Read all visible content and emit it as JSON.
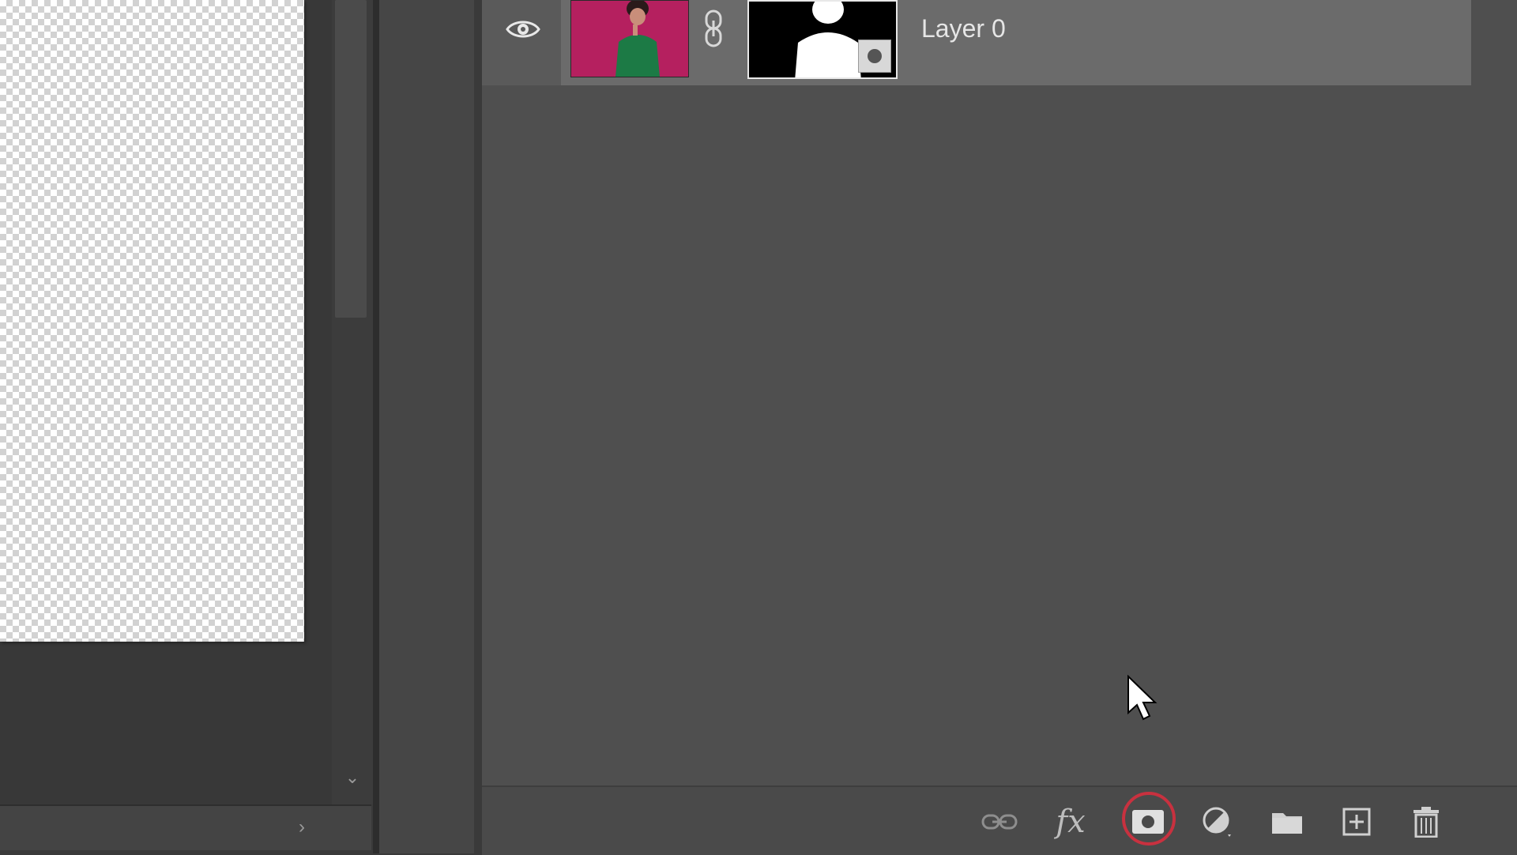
{
  "layers": [
    {
      "name": "Layer 0",
      "visible": true,
      "has_mask": true,
      "thumbnail_bg_color": "#b5205f"
    }
  ],
  "bottom_toolbar": {
    "link_icon": "link-layers-icon",
    "fx_label": "fx",
    "add_mask_icon": "add-layer-mask-icon",
    "adjustment_icon": "adjustment-layer-icon",
    "group_icon": "folder-icon",
    "new_layer_icon": "new-layer-icon",
    "delete_icon": "trash-icon",
    "highlighted": "add-layer-mask-icon"
  },
  "colors": {
    "highlight_ring": "#c8313f",
    "panel_bg": "#4f4f4f",
    "selected_row": "#6b6b6b"
  }
}
